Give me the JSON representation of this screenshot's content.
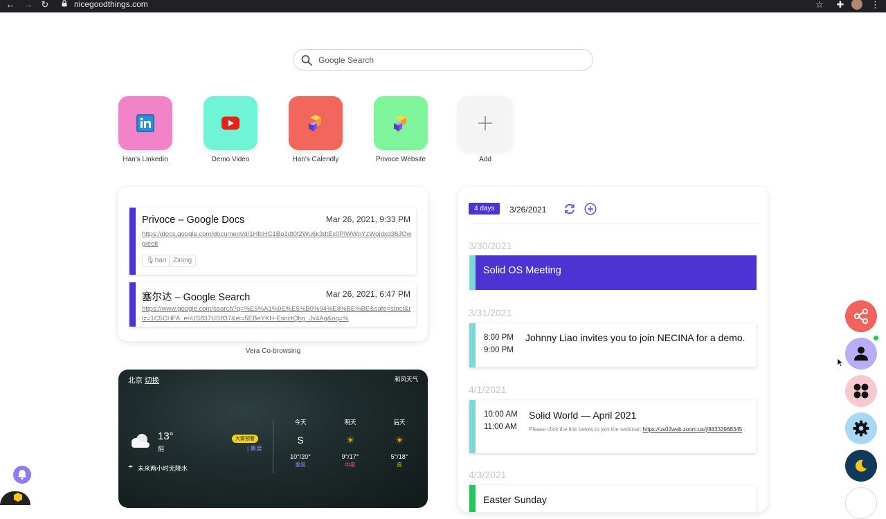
{
  "browser": {
    "url": "nicegoodthings.com"
  },
  "search": {
    "placeholder": "Google Search"
  },
  "shortcuts": [
    {
      "label": "Han's Linkedin",
      "color": "#f283c8",
      "icon": "linkedin-icon"
    },
    {
      "label": "Demo Video",
      "color": "#6ff5d6",
      "icon": "youtube-icon"
    },
    {
      "label": "Han's Calendly",
      "color": "#f2665c",
      "icon": "cube-icon"
    },
    {
      "label": "Privoce Website",
      "color": "#7ff59b",
      "icon": "cube-icon"
    },
    {
      "label": "Add",
      "color": "#f4f4f4",
      "icon": "plus-icon"
    }
  ],
  "cobrowsing": {
    "items": [
      {
        "title": "Privoce – Google Docs",
        "date": "Mar 26, 2021, 9:33 PM",
        "url": "https://docs.google.com/document/d/1HlbHC1Bo1dt0f2Wu6k3dtEx0PlWWpYzWojdxd36JOwg/edit",
        "tags": [
          "han",
          "Zining"
        ]
      },
      {
        "title": "塞尔达 – Google Search",
        "date": "Mar 26, 2021, 6:47 PM",
        "url": "https://www.google.com/search?q=%E5%A1%9E%E5%B0%94%E8%BE%BE&safe=strict&rlz=1C5CHFA_enUS837US837&ei=5EBeYKH-EsnctQbg_Jv4Ag&oq=%"
      }
    ],
    "caption": "Vera Co-browsing"
  },
  "weather": {
    "city": "北京",
    "switch_label": "切换",
    "provider": "和风天气",
    "temp": "13°",
    "condition": "阴",
    "alert": "大雾预警",
    "aqi": "| 重度",
    "rain": "未来两小时无降水",
    "forecast": [
      {
        "day": "今天",
        "symbol": "S",
        "range": "10°/20°",
        "quality": "重度",
        "quality_color": "#9a8cf0"
      },
      {
        "day": "明天",
        "symbol": "☀",
        "range": "9°/17°",
        "quality": "中度",
        "quality_color": "#f0587a"
      },
      {
        "day": "后天",
        "symbol": "☀",
        "range": "5°/18°",
        "quality": "良",
        "quality_color": "#f2d21b"
      }
    ]
  },
  "calendar": {
    "range": "4 days",
    "date": "3/26/2021",
    "days": [
      {
        "date": "3/30/2021"
      },
      {
        "date": "3/31/2021"
      },
      {
        "date": "4/1/2021"
      },
      {
        "date": "4/3/2021"
      }
    ],
    "events": {
      "e1": {
        "title": "Solid OS Meeting"
      },
      "e2": {
        "start": "8:00 PM",
        "end": "9:00 PM",
        "title": "Johnny Liao invites you to join NECINA for a demo."
      },
      "e3": {
        "start": "10:00 AM",
        "end": "11:00 AM",
        "title": "Solid World — April 2021",
        "note": "Please click the link below to join the webinar:",
        "link": "https://us02web.zoom.us/j/88333968345",
        "note_end": "."
      },
      "e4": {
        "title": "Easter Sunday"
      }
    }
  },
  "fabs": [
    {
      "name": "share",
      "color": "#f2625c"
    },
    {
      "name": "profile",
      "color": "#b8aef5"
    },
    {
      "name": "apps",
      "color": "#f7c9cf"
    },
    {
      "name": "settings",
      "color": "#a9d8f5"
    },
    {
      "name": "dark-mode",
      "color": "#0f3a5c"
    }
  ]
}
